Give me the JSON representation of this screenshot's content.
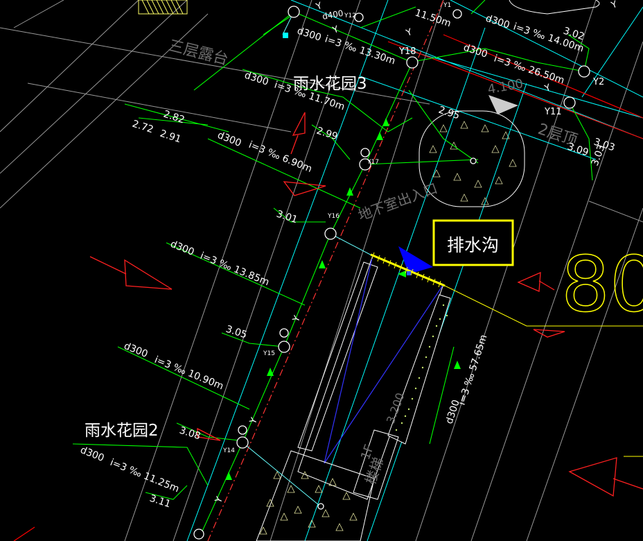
{
  "labels": {
    "title_drain": "排水沟",
    "garden3": "雨水花园3",
    "garden2": "雨水花园2",
    "terrace": "三层露台",
    "underground_exit": "地下室出入口",
    "roof2": "2层顶",
    "stairs1": "1F",
    "stairs2": "楼梯",
    "big_number": "80",
    "elev_4100": "4.100",
    "elev_3200": "3.200"
  },
  "nodes": {
    "y18": "Y18",
    "y17": "Y17",
    "y16": "Y16",
    "y15": "Y15",
    "y14": "Y14",
    "y11": "Y11",
    "y2": "Y2",
    "y12": "Y12",
    "y1": "Y1"
  },
  "pipes": {
    "p1_d": "d300",
    "p1_i": "i=3 ‰ 13.30m",
    "p2_d": "d300",
    "p2_i": "i=3 ‰ 11.70m",
    "p3_d": "d300",
    "p3_i": "i=3 ‰ 6.90m",
    "p4_d": "d300",
    "p4_i": "i=3 ‰ 13.85m",
    "p5_d": "d300",
    "p5_i": "i=3 ‰ 10.90m",
    "p6_d": "d300",
    "p6_i": "i=3 ‰ 11.25m",
    "p7_d": "d300",
    "p7_i": "i=3 ‰ 26.50m",
    "p8_d": "d300",
    "p8_i": "i=3 ‰ 14.00m",
    "p9_d": "d300",
    "p9_i": "i=3 ‰ 57.65m",
    "p10_len": "11.50m",
    "top_d": "d400"
  },
  "elevations": {
    "e282": "2.82",
    "e272": "2.72",
    "e291": "2.91",
    "e299": "2.99",
    "e295": "2.95",
    "e301": "3.01",
    "e305": "3.05",
    "e308": "3.08",
    "e311": "3.11",
    "e302": "3.02",
    "e303": "3.03",
    "e303b": "3.03",
    "e309": "3.09"
  },
  "axis": {
    "y": "Y"
  },
  "colors": {
    "background": "#000000",
    "cad_white": "#ffffff",
    "pipe_green": "#00ff00",
    "grid_cyan": "#00ffff",
    "red": "#ff0000",
    "yellow": "#ffff00",
    "blue": "#0000ff",
    "gray_text": "#6e6e6e"
  }
}
